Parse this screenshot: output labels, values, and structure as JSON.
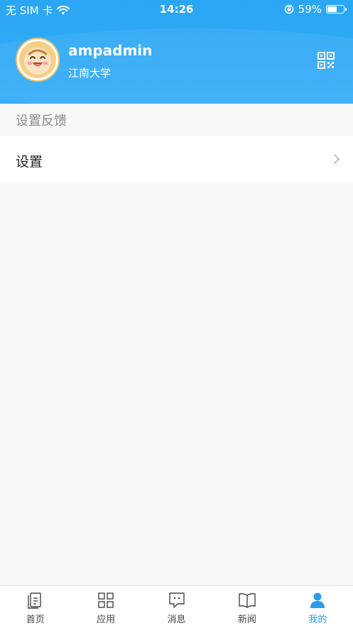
{
  "status_bar": {
    "carrier": "无 SIM 卡",
    "time": "14:26",
    "battery_percent_text": "59%",
    "battery_level": 0.59
  },
  "profile": {
    "username": "ampadmin",
    "school": "江南大学",
    "qr_icon": "qr-code-icon"
  },
  "section": {
    "title": "设置反馈"
  },
  "menu": {
    "settings_label": "设置"
  },
  "tabbar": {
    "tabs": [
      {
        "label": "首页",
        "icon": "home-icon"
      },
      {
        "label": "应用",
        "icon": "apps-grid-icon"
      },
      {
        "label": "消息",
        "icon": "message-icon"
      },
      {
        "label": "新闻",
        "icon": "news-book-icon"
      },
      {
        "label": "我的",
        "icon": "profile-icon"
      }
    ],
    "active_index": 4
  },
  "colors": {
    "header_blue": "#37aef8",
    "active_tab": "#2a9bea"
  }
}
